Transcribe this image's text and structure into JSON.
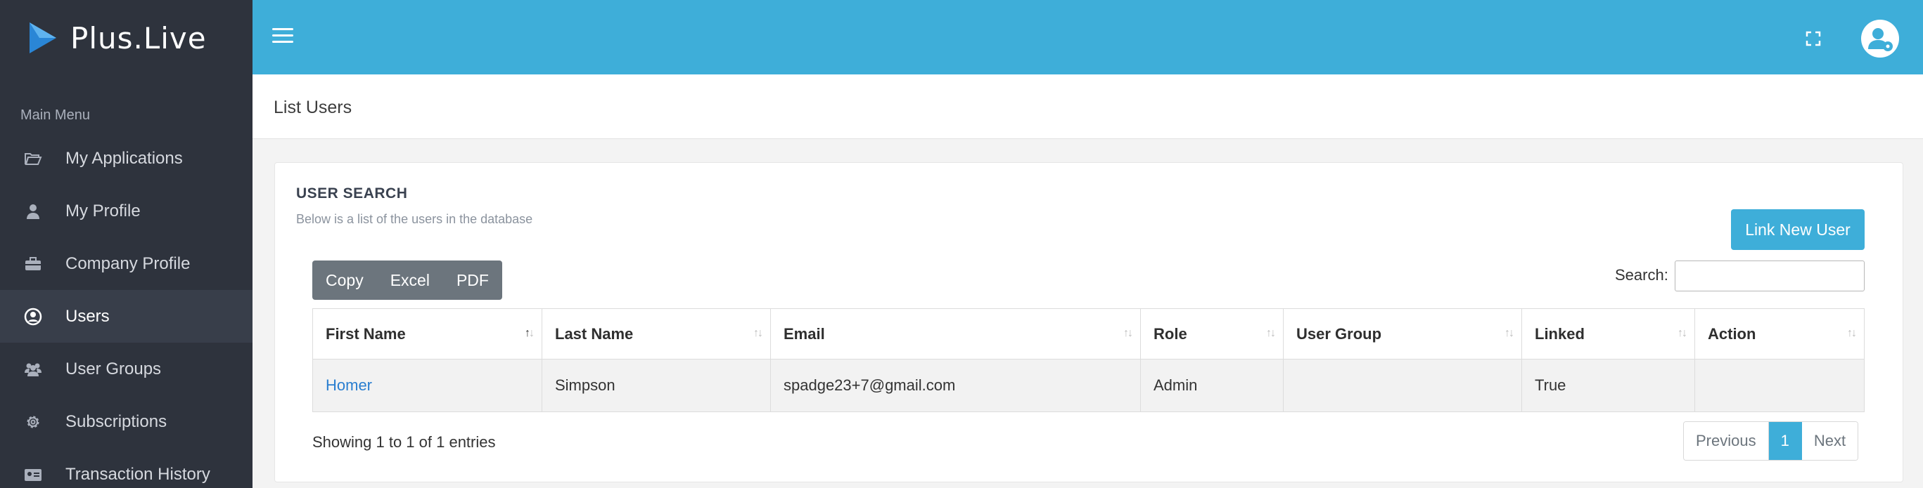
{
  "brand": {
    "name": "Plus.Live"
  },
  "sidebar": {
    "heading": "Main Menu",
    "items": [
      {
        "label": "My Applications",
        "icon": "folder-open-icon"
      },
      {
        "label": "My Profile",
        "icon": "user-icon"
      },
      {
        "label": "Company Profile",
        "icon": "briefcase-icon"
      },
      {
        "label": "Users",
        "icon": "user-circle-icon",
        "active": true
      },
      {
        "label": "User Groups",
        "icon": "users-icon"
      },
      {
        "label": "Subscriptions",
        "icon": "gear-icon"
      },
      {
        "label": "Transaction History",
        "icon": "id-card-icon"
      }
    ]
  },
  "page": {
    "title": "List Users"
  },
  "card": {
    "title": "USER SEARCH",
    "subtitle": "Below is a list of the users in the database",
    "link_button": "Link New User"
  },
  "export": {
    "copy": "Copy",
    "excel": "Excel",
    "pdf": "PDF"
  },
  "search": {
    "label": "Search:",
    "value": ""
  },
  "table": {
    "columns": [
      "First Name",
      "Last Name",
      "Email",
      "Role",
      "User Group",
      "Linked",
      "Action"
    ],
    "rows": [
      {
        "first_name": "Homer",
        "last_name": "Simpson",
        "email": "spadge23+7@gmail.com",
        "role": "Admin",
        "user_group": "",
        "linked": "True",
        "action": ""
      }
    ]
  },
  "footer": {
    "info": "Showing 1 to 1 of 1 entries"
  },
  "pagination": {
    "previous": "Previous",
    "current": "1",
    "next": "Next"
  },
  "colors": {
    "topbar": "#3eaed9",
    "sidebar": "#2e333d",
    "accent": "#3eaed9",
    "export_group": "#6c757d"
  }
}
